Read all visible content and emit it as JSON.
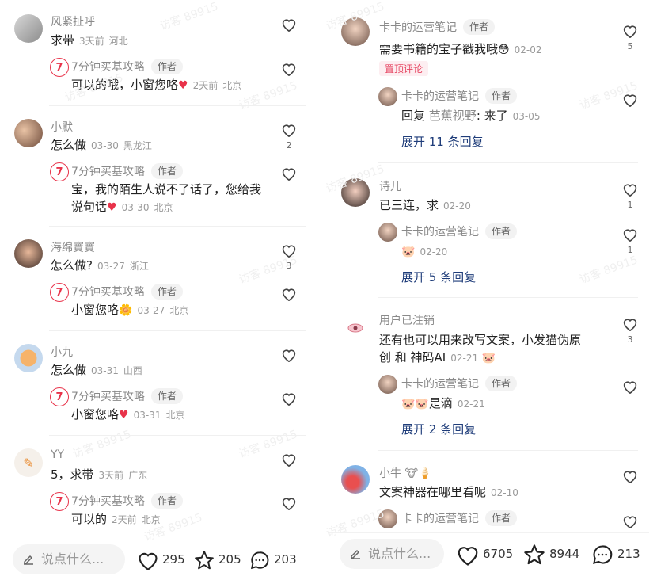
{
  "left": {
    "comments": [
      {
        "user": "风紧扯呼",
        "text": "求带",
        "time": "3天前",
        "loc": "河北",
        "likes": "",
        "reply": {
          "user": "7分钟买基攻略",
          "tag": "作者",
          "text": "可以的哦，小窗您咯",
          "emoji": "♥",
          "time": "2天前",
          "loc": "北京"
        }
      },
      {
        "user": "小默",
        "text": "怎么做",
        "time": "03-30",
        "loc": "黑龙江",
        "likes": "2",
        "reply": {
          "user": "7分钟买基攻略",
          "tag": "作者",
          "text": "宝，我的陌生人说不了话了，您给我",
          "text2": "说句话",
          "emoji": "♥",
          "time": "03-30",
          "loc": "北京"
        }
      },
      {
        "user": "海绵寶寶",
        "text": "怎么做?",
        "time": "03-27",
        "loc": "浙江",
        "likes": "3",
        "reply": {
          "user": "7分钟买基攻略",
          "tag": "作者",
          "text": "小窗您咯",
          "emoji": "🌼",
          "time": "03-27",
          "loc": "北京"
        }
      },
      {
        "user": "小九",
        "text": "怎么做",
        "time": "03-31",
        "loc": "山西",
        "likes": "",
        "reply": {
          "user": "7分钟买基攻略",
          "tag": "作者",
          "text": "小窗您咯",
          "emoji": "♥",
          "time": "03-31",
          "loc": "北京"
        }
      },
      {
        "user": "YY",
        "text": "5，求带",
        "time": "3天前",
        "loc": "广东",
        "likes": "",
        "reply": {
          "user": "7分钟买基攻略",
          "tag": "作者",
          "text": "可以的",
          "emoji": "",
          "time": "2天前",
          "loc": "北京"
        }
      }
    ],
    "bottom": {
      "placeholder": "说点什么...",
      "likes": "295",
      "stars": "205",
      "comments": "203"
    }
  },
  "right": {
    "c1": {
      "user": "卡卡的运营笔记",
      "tag": "作者",
      "text": "需要书籍的宝子戳我哦",
      "time": "02-02",
      "likes": "5",
      "pin": "置顶评论",
      "reply": {
        "user": "卡卡的运营笔记",
        "tag": "作者",
        "prefix": "回复",
        "target": "芭蕉视野",
        "text": ": 来了",
        "time": "03-05"
      },
      "expand": "展开 11 条回复"
    },
    "c2": {
      "user": "诗儿",
      "text": "已三连，求",
      "time": "02-20",
      "likes": "1",
      "reply": {
        "user": "卡卡的运营笔记",
        "tag": "作者",
        "text": "",
        "time": "02-20",
        "likes": "1"
      },
      "expand": "展开 5 条回复"
    },
    "c3": {
      "user": "用户已注销",
      "text": "还有也可以用来改写文案，小发猫伪原",
      "text2": "创 和 神码AI",
      "time": "02-21",
      "likes": "3",
      "reply": {
        "user": "卡卡的运营笔记",
        "tag": "作者",
        "text": "是滴",
        "time": "02-21"
      },
      "expand": "展开 2 条回复"
    },
    "c4": {
      "user": "小牛",
      "text": "文案神器在哪里看呢",
      "time": "02-10",
      "reply": {
        "user": "卡卡的运营笔记",
        "tag": "作者"
      }
    },
    "bottom": {
      "placeholder": "说点什么...",
      "likes": "6705",
      "stars": "8944",
      "comments": "213"
    }
  },
  "watermark": "访客 89915"
}
